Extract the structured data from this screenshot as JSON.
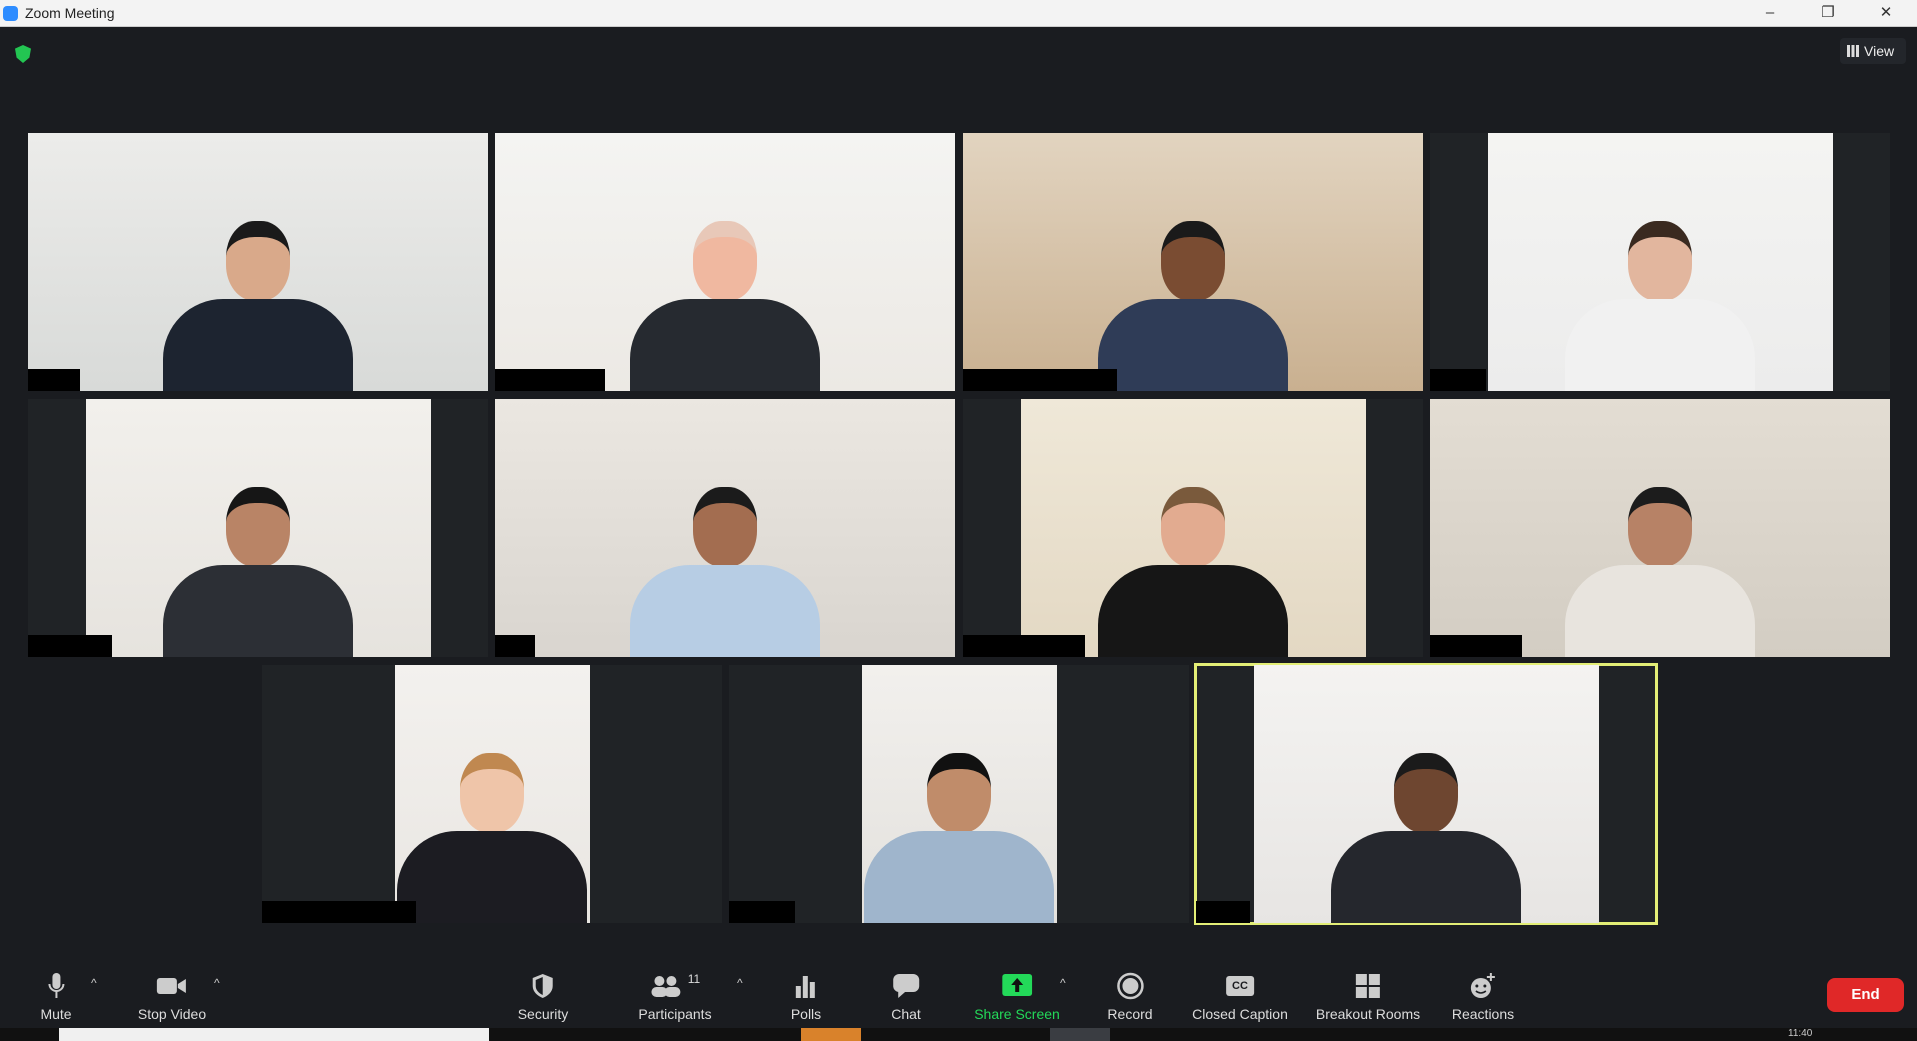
{
  "window": {
    "title": "Zoom Meeting",
    "minimize": "–",
    "maximize": "❐",
    "close": "✕"
  },
  "header": {
    "view_label": "View",
    "encryption_icon": "shield-check-icon"
  },
  "tiles": [
    {
      "bg": "#d8dad8",
      "wall": "#ececea",
      "skin": "#d9a98a",
      "suit": "#1d2430",
      "hair": "#1a1a1a",
      "name_w": 52,
      "active": false
    },
    {
      "bg": "#ece9e4",
      "wall": "#f4f4f2",
      "skin": "#f0b8a0",
      "suit": "#262a30",
      "hair": "#e8c8b8",
      "name_w": 110,
      "active": false
    },
    {
      "bg": "#c9b090",
      "wall": "#e2d4c0",
      "skin": "#7a4c32",
      "suit": "#2f3c57",
      "hair": "#1a1a1a",
      "name_w": 154,
      "active": false
    },
    {
      "bg": "#ececec",
      "wall": "#f4f4f2",
      "skin": "#e2b69e",
      "suit": "#f1f1f1",
      "hair": "#3a2a20",
      "name_w": 56,
      "active": false
    },
    {
      "bg": "#e6e3de",
      "wall": "#f2f0ec",
      "skin": "#b98466",
      "suit": "#2c2f35",
      "hair": "#161616",
      "name_w": 84,
      "active": false
    },
    {
      "bg": "#d9d5cf",
      "wall": "#ebe7e1",
      "skin": "#a36d50",
      "suit": "#b7cde4",
      "hair": "#1b1b1b",
      "name_w": 40,
      "active": false
    },
    {
      "bg": "#e3d8c3",
      "wall": "#efe8d8",
      "skin": "#e2ab90",
      "suit": "#161616",
      "hair": "#7a5a3c",
      "name_w": 122,
      "active": false
    },
    {
      "bg": "#d3cdc3",
      "wall": "#e3ddd3",
      "skin": "#b78266",
      "suit": "#e8e4de",
      "hair": "#1c1c1c",
      "name_w": 92,
      "active": false
    },
    {
      "bg": "#e9e6e2",
      "wall": "#f3f1ee",
      "skin": "#efc5a9",
      "suit": "#1c1c22",
      "hair": "#c08850",
      "name_w": 154,
      "active": false
    },
    {
      "bg": "#e3e1dd",
      "wall": "#f2f0ed",
      "skin": "#c08c6a",
      "suit": "#9fb5cc",
      "hair": "#111",
      "name_w": 66,
      "active": false
    },
    {
      "bg": "#e7e5e3",
      "wall": "#f4f3f1",
      "skin": "#6e4630",
      "suit": "#25272d",
      "hair": "#1b1b1b",
      "name_w": 54,
      "active": true
    }
  ],
  "toolbar": {
    "mute": {
      "label": "Mute",
      "icon": "microphone-icon"
    },
    "video": {
      "label": "Stop Video",
      "icon": "video-camera-icon"
    },
    "security": {
      "label": "Security",
      "icon": "shield-icon"
    },
    "participants": {
      "label": "Participants",
      "count": "11",
      "icon": "participants-icon"
    },
    "polls": {
      "label": "Polls",
      "icon": "bar-chart-icon"
    },
    "chat": {
      "label": "Chat",
      "icon": "chat-bubble-icon"
    },
    "share": {
      "label": "Share Screen",
      "icon": "share-screen-icon",
      "color": "#23d959"
    },
    "record": {
      "label": "Record",
      "icon": "record-icon"
    },
    "cc": {
      "label": "Closed Caption",
      "icon_text": "CC"
    },
    "breakout": {
      "label": "Breakout Rooms",
      "icon": "breakout-rooms-icon"
    },
    "reactions": {
      "label": "Reactions",
      "icon": "smiley-plus-icon"
    },
    "end": {
      "label": "End",
      "color": "#e02828"
    }
  },
  "taskbar": {
    "clock": "11:40"
  }
}
